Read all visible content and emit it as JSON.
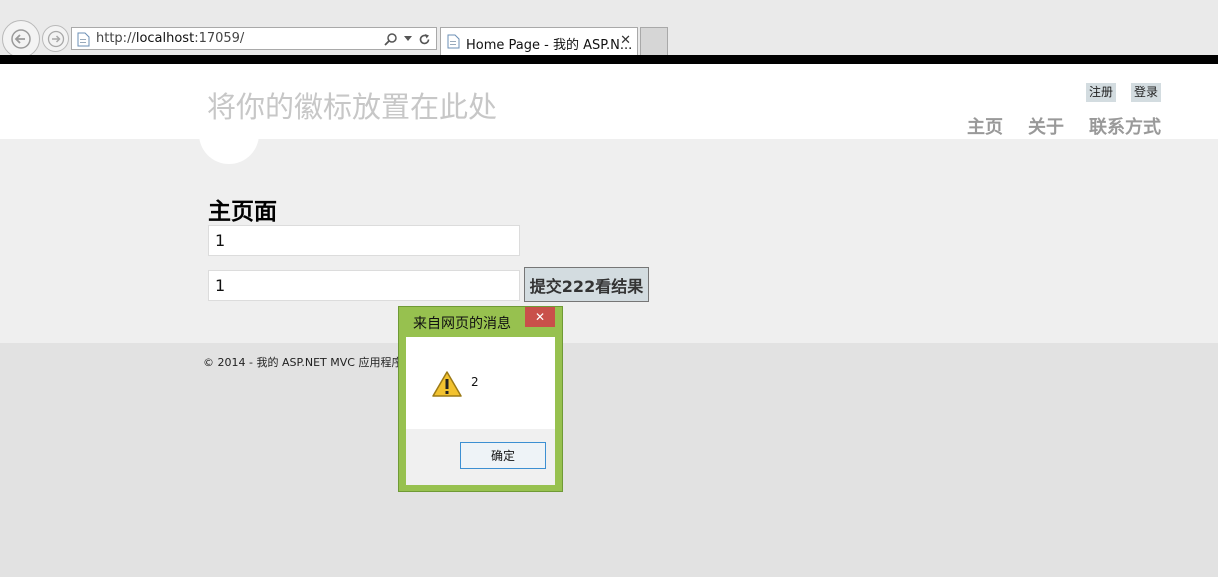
{
  "browser": {
    "url_prefix": "http://",
    "url_host": "localhost",
    "url_rest": ":17059/",
    "tab_title": "Home Page - 我的 ASP.N...",
    "tab_close": "✕"
  },
  "header": {
    "site_title": "将你的徽标放置在此处",
    "register_label": "注册",
    "login_label": "登录",
    "nav": [
      "主页",
      "关于",
      "联系方式"
    ]
  },
  "main": {
    "heading": "主页面",
    "input1_value": "1",
    "input2_value": "1",
    "submit_label": "提交222看结果"
  },
  "footer": {
    "text": "© 2014 - 我的 ASP.NET MVC 应用程序"
  },
  "dialog": {
    "title": "来自网页的消息",
    "close_glyph": "✕",
    "message": "2",
    "ok_label": "确定"
  },
  "colors": {
    "dialog_frame": "#97c14f",
    "dialog_close": "#c9504a",
    "button_bg": "#d3dce0"
  }
}
